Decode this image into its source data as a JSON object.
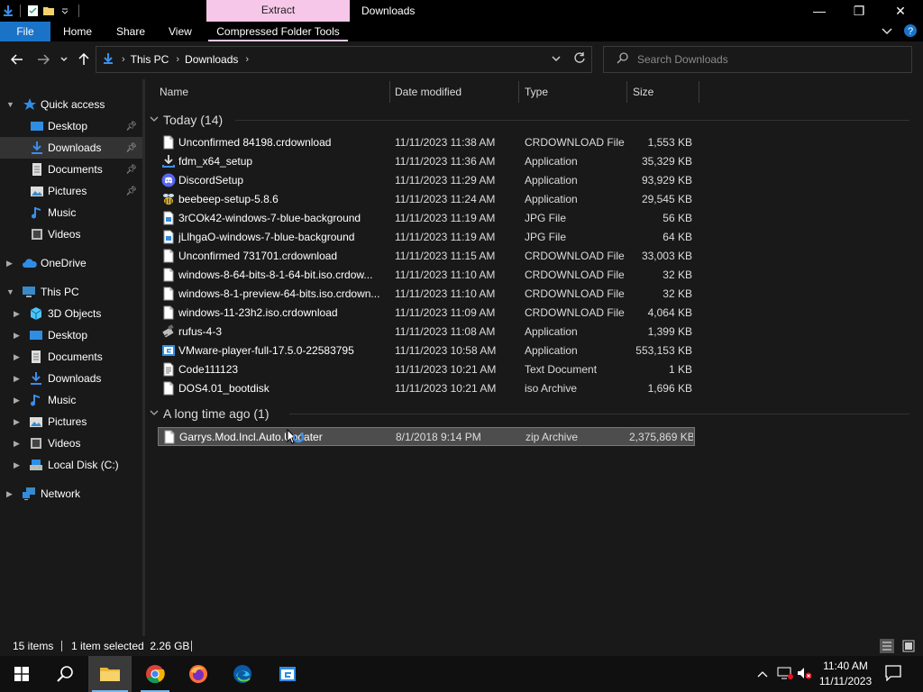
{
  "window": {
    "title": "Downloads",
    "contextual_tab": "Extract",
    "controls": {
      "minimize": "—",
      "maximize": "❐",
      "close": "✕"
    }
  },
  "ribbon": {
    "file": "File",
    "tabs": [
      "Home",
      "Share",
      "View",
      "Compressed Folder Tools"
    ]
  },
  "address": {
    "crumbs": [
      "This PC",
      "Downloads"
    ]
  },
  "search": {
    "placeholder": "Search Downloads"
  },
  "navpane": {
    "quick_access": "Quick access",
    "desktop": "Desktop",
    "downloads": "Downloads",
    "documents": "Documents",
    "pictures": "Pictures",
    "music": "Music",
    "videos": "Videos",
    "onedrive": "OneDrive",
    "this_pc": "This PC",
    "objects3d": "3D Objects",
    "pc_desktop": "Desktop",
    "pc_documents": "Documents",
    "pc_downloads": "Downloads",
    "pc_music": "Music",
    "pc_pictures": "Pictures",
    "pc_videos": "Videos",
    "local_disk": "Local Disk (C:)",
    "network": "Network"
  },
  "columns": {
    "name": "Name",
    "date": "Date modified",
    "type": "Type",
    "size": "Size"
  },
  "groups": {
    "today": "Today (14)",
    "long_ago": "A long time ago (1)"
  },
  "today_files": [
    {
      "name": "Unconfirmed 84198.crdownload",
      "date": "11/11/2023 11:38 AM",
      "type": "CRDOWNLOAD File",
      "size": "1,553 KB",
      "icon": "blank-file-icon"
    },
    {
      "name": "fdm_x64_setup",
      "date": "11/11/2023 11:36 AM",
      "type": "Application",
      "size": "35,329 KB",
      "icon": "download-app-icon"
    },
    {
      "name": "DiscordSetup",
      "date": "11/11/2023 11:29 AM",
      "type": "Application",
      "size": "93,929 KB",
      "icon": "discord-icon"
    },
    {
      "name": "beebeep-setup-5.8.6",
      "date": "11/11/2023 11:24 AM",
      "type": "Application",
      "size": "29,545 KB",
      "icon": "bee-app-icon"
    },
    {
      "name": "3rCOk42-windows-7-blue-background",
      "date": "11/11/2023 11:19 AM",
      "type": "JPG File",
      "size": "56 KB",
      "icon": "image-file-icon"
    },
    {
      "name": "jLlhgaO-windows-7-blue-background",
      "date": "11/11/2023 11:19 AM",
      "type": "JPG File",
      "size": "64 KB",
      "icon": "image-file-icon"
    },
    {
      "name": "Unconfirmed 731701.crdownload",
      "date": "11/11/2023 11:15 AM",
      "type": "CRDOWNLOAD File",
      "size": "33,003 KB",
      "icon": "blank-file-icon"
    },
    {
      "name": "windows-8-64-bits-8-1-64-bit.iso.crdow...",
      "date": "11/11/2023 11:10 AM",
      "type": "CRDOWNLOAD File",
      "size": "32 KB",
      "icon": "blank-file-icon"
    },
    {
      "name": "windows-8-1-preview-64-bits.iso.crdown...",
      "date": "11/11/2023 11:10 AM",
      "type": "CRDOWNLOAD File",
      "size": "32 KB",
      "icon": "blank-file-icon"
    },
    {
      "name": "windows-11-23h2.iso.crdownload",
      "date": "11/11/2023 11:09 AM",
      "type": "CRDOWNLOAD File",
      "size": "4,064 KB",
      "icon": "blank-file-icon"
    },
    {
      "name": "rufus-4-3",
      "date": "11/11/2023 11:08 AM",
      "type": "Application",
      "size": "1,399 KB",
      "icon": "usb-app-icon"
    },
    {
      "name": "VMware-player-full-17.5.0-22583795",
      "date": "11/11/2023 10:58 AM",
      "type": "Application",
      "size": "553,153 KB",
      "icon": "installer-app-icon"
    },
    {
      "name": "Code111123",
      "date": "11/11/2023 10:21 AM",
      "type": "Text Document",
      "size": "1 KB",
      "icon": "text-file-icon"
    },
    {
      "name": "DOS4.01_bootdisk",
      "date": "11/11/2023 10:21 AM",
      "type": "iso Archive",
      "size": "1,696 KB",
      "icon": "blank-file-icon"
    }
  ],
  "old_files": [
    {
      "name": "Garrys.Mod.Incl.Auto.Updater",
      "date": "8/1/2018 9:14 PM",
      "type": "zip Archive",
      "size": "2,375,869 KB",
      "icon": "blank-file-icon"
    }
  ],
  "status": {
    "items": "15 items",
    "selected": "1 item selected  2.26 GB"
  },
  "taskbar": {
    "time": "11:40 AM",
    "date": "11/11/2023"
  }
}
